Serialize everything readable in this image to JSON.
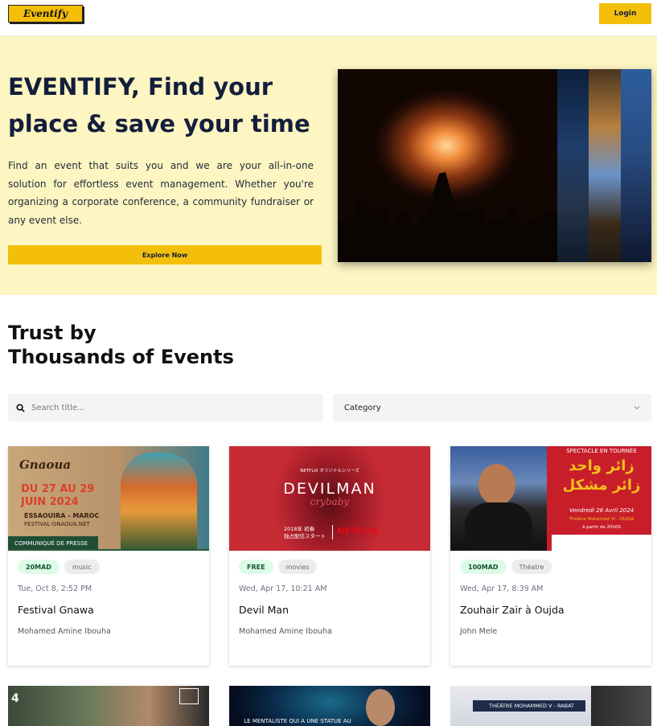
{
  "brand": {
    "logo_text": "Eventify"
  },
  "header": {
    "login_label": "Login"
  },
  "hero": {
    "title": "EVENTIFY, Find your place & save your time",
    "description": "Find an event that suits you and we are your all-in-one solution for effortless event management. Whether you're organizing a corporate conference, a community fundraiser or any event else.",
    "cta_label": "Explore Now"
  },
  "section": {
    "title_line1": "Trust by",
    "title_line2": "Thousands of Events"
  },
  "filters": {
    "search_placeholder": "Search title...",
    "category_label": "Category"
  },
  "events": [
    {
      "price": "20MAD",
      "category": "music",
      "date": "Tue, Oct 8, 2:52 PM",
      "title": "Festival Gnawa",
      "author": "Mohamed Amine Ibouha",
      "poster_text1": "Gnaoua",
      "poster_text2": "DU 27 AU 29",
      "poster_text3": "JUIN 2024",
      "poster_text4": "ESSAOUIRA - MAROC",
      "poster_text5": "FESTIVAL-GNAOUA.NET",
      "poster_text6": "COMMUNIQUÉ DE PRESSE"
    },
    {
      "price": "FREE",
      "category": "movies",
      "date": "Wed, Apr 17, 10:21 AM",
      "title": "Devil Man",
      "author": "Mohamed Amine Ibouha",
      "poster_text1": "NETFLIX オリジナルシリーズ",
      "poster_text2": "DEVILMAN",
      "poster_text3": "crybaby",
      "poster_text4": "2018年 初春",
      "poster_text5": "独占配信スタート",
      "poster_text6": "NETFLIX"
    },
    {
      "price": "100MAD",
      "category": "Théatre",
      "date": "Wed, Apr 17, 8:39 AM",
      "title": "Zouhair Zair à Oujda",
      "author": "John Mele",
      "poster_text1": "SPECTACLE EN TOURNÉE",
      "poster_text2": "زائر واحد",
      "poster_text3": "زائر مشكل",
      "poster_text4": "Vendredi 26 Avril 2024",
      "poster_text5": "Théâtre Mohamed VI - OUJDA",
      "poster_text6": "à partir de 20h00"
    }
  ],
  "next_row": [
    {
      "poster_text": ""
    },
    {
      "poster_text": "LE MENTALISTE QUI A UNE STATUE AU"
    },
    {
      "poster_text": "THÉÂTRE MOHAMMED V - RABAT"
    }
  ]
}
